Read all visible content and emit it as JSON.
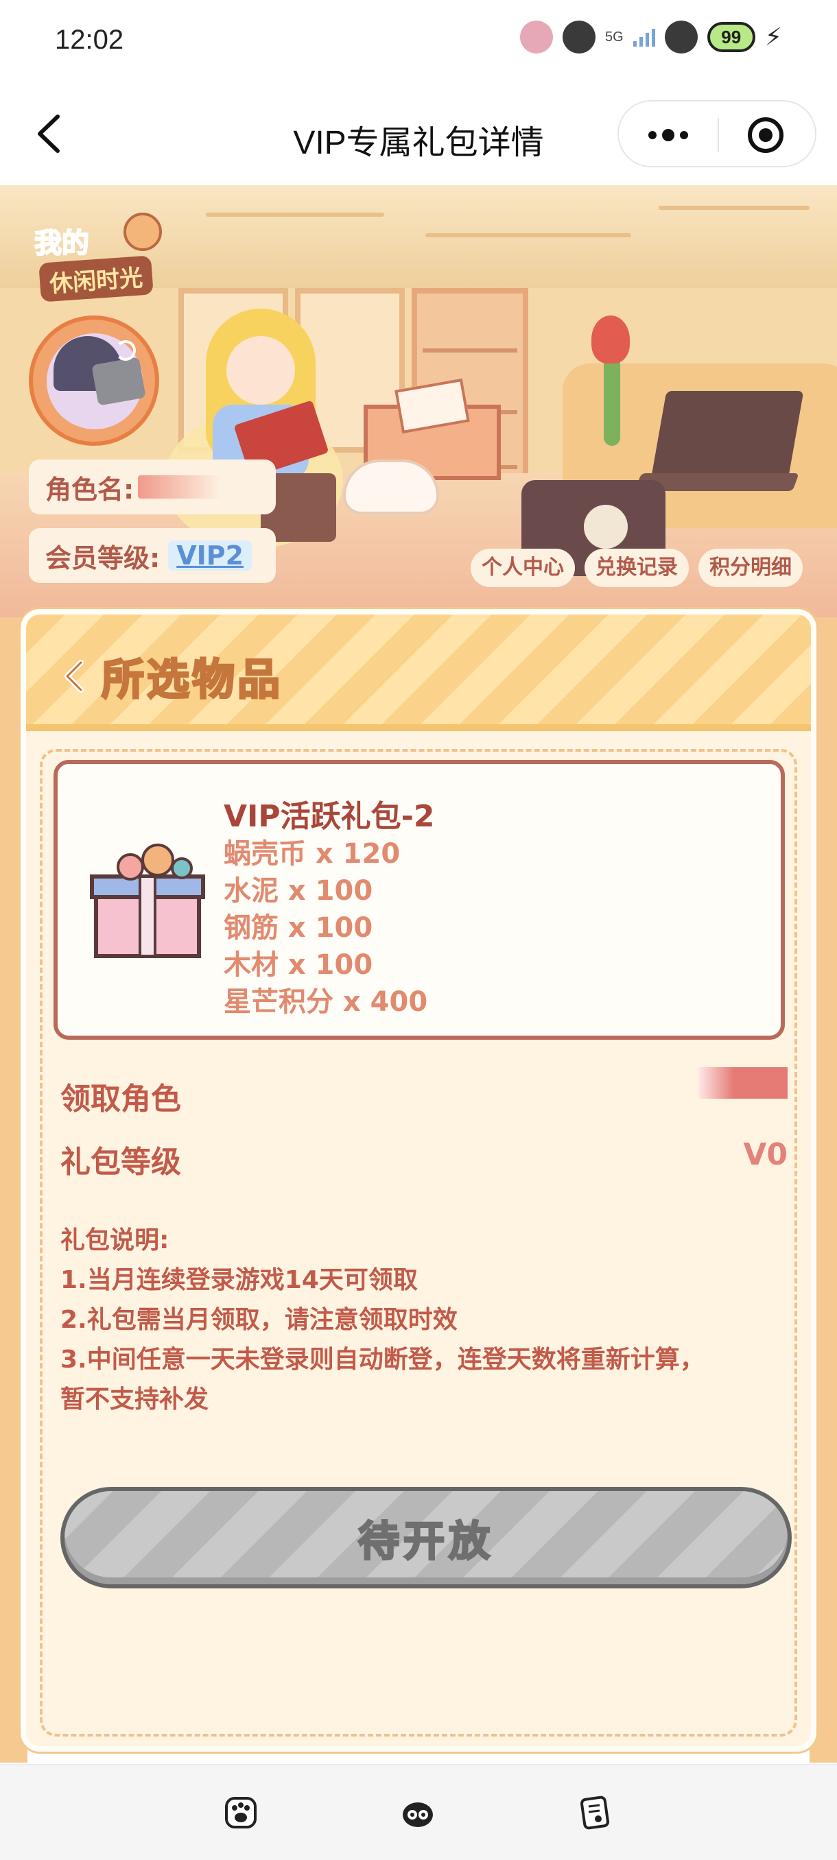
{
  "status_bar": {
    "time": "12:02",
    "network": "5G",
    "battery": "99"
  },
  "nav": {
    "title": "VIP专属礼包详情",
    "back_icon": "chevron-left-icon",
    "more_icon": "more-dots-icon",
    "close_icon": "target-circle-icon"
  },
  "hero": {
    "logo_line1": "我的",
    "logo_line2": "休闲时光",
    "role_name_label": "角色名:",
    "member_level_label": "会员等级:",
    "member_level_value": "VIP2",
    "tabs": [
      "个人中心",
      "兑换记录",
      "积分明细"
    ]
  },
  "card": {
    "header_title": "所选物品",
    "gift": {
      "name": "VIP活跃礼包-2",
      "items": [
        "蜗壳币 x 120",
        "水泥 x 100",
        "钢筋 x 100",
        "木材 x 100",
        "星芒积分 x 400"
      ]
    },
    "claim_role_label": "领取角色",
    "gift_level_label": "礼包等级",
    "gift_level_value": "V0",
    "description_title": "礼包说明:",
    "description_lines": [
      "1.当月连续登录游戏14天可领取",
      "2.礼包需当月领取，请注意领取时效",
      "3.中间任意一天未登录则自动断登，连登天数将重新计算，",
      "暂不支持补发"
    ],
    "button_label": "待开放"
  },
  "bottom_bar": {
    "icons": [
      "paw-icon",
      "cat-face-icon",
      "document-icon"
    ]
  }
}
